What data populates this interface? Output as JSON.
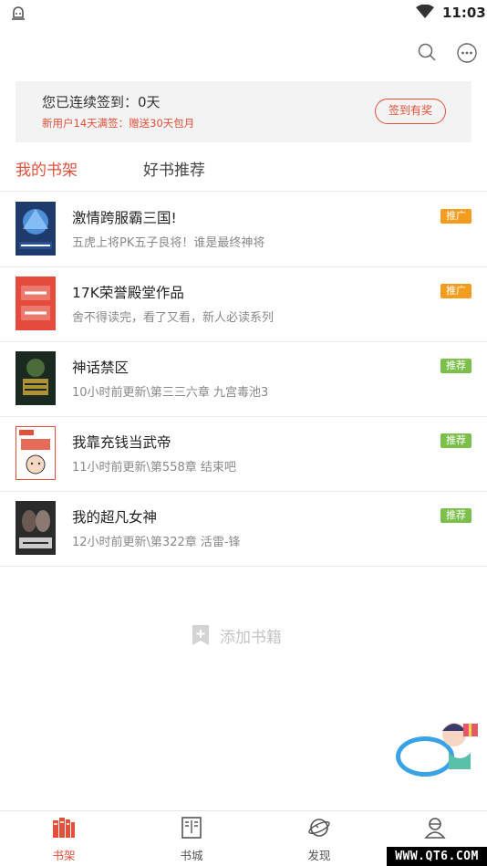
{
  "status_bar": {
    "time": "11:03"
  },
  "icons": {
    "notification": "notification-icon",
    "wifi": "wifi-icon",
    "search": "search-icon",
    "more": "more-icon",
    "add": "add-icon"
  },
  "signin": {
    "title": "您已连续签到：0天",
    "subtitle": "新用户14天满签：赠送30天包月",
    "button": "签到有奖"
  },
  "tabs": [
    {
      "label": "我的书架",
      "active": true
    },
    {
      "label": "好书推荐",
      "active": false
    }
  ],
  "books": [
    {
      "title": "激情跨服霸三国!",
      "desc": "五虎上将PK五子良将！谁是最终神将",
      "badge": "推广",
      "badge_color": "#f39c1e",
      "cover_text": ""
    },
    {
      "title": "17K荣誉殿堂作品",
      "desc": "舍不得读完，看了又看，新人必读系列",
      "badge": "推广",
      "badge_color": "#f39c1e",
      "cover_text": ""
    },
    {
      "title": "神话禁区",
      "desc": "10小时前更新\\第三三六章 九宫毒池3",
      "badge": "推荐",
      "badge_color": "#7cbf4b",
      "cover_text": ""
    },
    {
      "title": "我靠充钱当武帝",
      "desc": "11小时前更新\\第558章 结束吧",
      "badge": "推荐",
      "badge_color": "#7cbf4b",
      "cover_text": ""
    },
    {
      "title": "我的超凡女神",
      "desc": "12小时前更新\\第322章 活雷-锋",
      "badge": "推荐",
      "badge_color": "#7cbf4b",
      "cover_text": ""
    }
  ],
  "add_book": {
    "label": "添加书籍"
  },
  "gift": {
    "label": "新手礼包"
  },
  "bottom_nav": [
    {
      "label": "书架",
      "active": true,
      "icon": "bookshelf-icon"
    },
    {
      "label": "书城",
      "active": false,
      "icon": "bookstore-icon"
    },
    {
      "label": "发现",
      "active": false,
      "icon": "discover-icon"
    },
    {
      "label": "我的",
      "active": false,
      "icon": "profile-icon"
    }
  ],
  "watermark": "WWW.QT6.COM",
  "colors": {
    "accent": "#e0503a",
    "badge_promo": "#f39c1e",
    "badge_recommend": "#7cbf4b"
  }
}
